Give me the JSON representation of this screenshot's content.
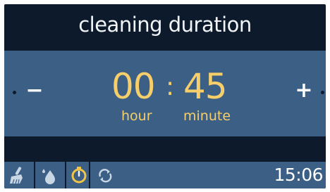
{
  "title": "cleaning duration",
  "duration": {
    "hours": "00",
    "separator": ":",
    "minutes": "45",
    "hour_unit": "hour",
    "minute_unit": "minute"
  },
  "controls": {
    "decrease_label": "−",
    "increase_label": "+"
  },
  "bottom_bar": {
    "modes": [
      {
        "icon": "brush-icon",
        "active": false
      },
      {
        "icon": "water-drop-icon",
        "active": false
      },
      {
        "icon": "timer-icon",
        "active": true
      },
      {
        "icon": "sync-icon",
        "active": false
      }
    ],
    "clock": "15:06"
  },
  "colors": {
    "background": "#0d1a2c",
    "band": "#3c5f86",
    "digits": "#f6cf6a",
    "text": "#f2f5f8",
    "active_icon": "#f0c445"
  }
}
